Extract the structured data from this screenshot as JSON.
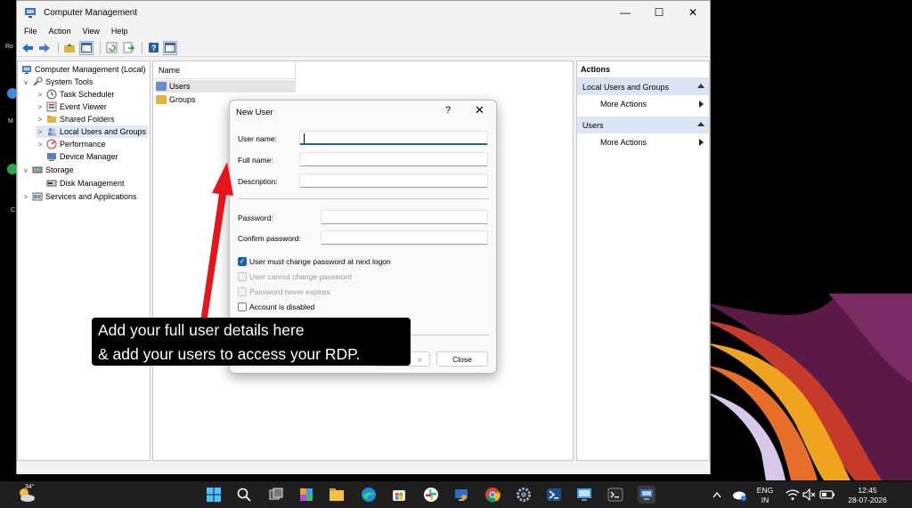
{
  "window": {
    "title": "Computer Management",
    "controls": [
      "minimize-icon",
      "maximize-icon",
      "close-icon"
    ]
  },
  "menu": [
    "File",
    "Action",
    "View",
    "Help"
  ],
  "tree": {
    "items": [
      {
        "label": "Computer Management (Local)",
        "level": 0,
        "expander": "",
        "icon": "computer-management-icon"
      },
      {
        "label": "System Tools",
        "level": 1,
        "expander": "v",
        "icon": "tools-icon"
      },
      {
        "label": "Task Scheduler",
        "level": 2,
        "expander": ">",
        "icon": "clock-icon"
      },
      {
        "label": "Event Viewer",
        "level": 2,
        "expander": ">",
        "icon": "event-viewer-icon"
      },
      {
        "label": "Shared Folders",
        "level": 2,
        "expander": ">",
        "icon": "shared-folders-icon"
      },
      {
        "label": "Local Users and Groups",
        "level": 2,
        "expander": ">",
        "icon": "users-icon"
      },
      {
        "label": "Performance",
        "level": 2,
        "expander": ">",
        "icon": "performance-icon"
      },
      {
        "label": "Device Manager",
        "level": 2,
        "expander": "",
        "icon": "device-manager-icon"
      },
      {
        "label": "Storage",
        "level": 1,
        "expander": "v",
        "icon": "storage-icon"
      },
      {
        "label": "Disk Management",
        "level": 2,
        "expander": "",
        "icon": "disk-icon"
      },
      {
        "label": "Services and Applications",
        "level": 1,
        "expander": ">",
        "icon": "services-icon"
      }
    ]
  },
  "list": {
    "column_header": "Name",
    "rows": [
      "Users",
      "Groups"
    ]
  },
  "actions": {
    "header": "Actions",
    "sections": [
      {
        "title": "Local Users and Groups",
        "item": "More Actions"
      },
      {
        "title": "Users",
        "item": "More Actions"
      }
    ]
  },
  "dialog": {
    "title": "New User",
    "help": "?",
    "close": "✕",
    "fields": {
      "user_name_label": "User name:",
      "user_name_value": "",
      "full_name_label": "Full name:",
      "full_name_value": "",
      "description_label": "Description:",
      "description_value": "",
      "password_label": "Password:",
      "password_value": "",
      "confirm_label": "Confirm password:",
      "confirm_value": ""
    },
    "checkboxes": [
      {
        "label": "User must change password at next logon",
        "checked": true,
        "disabled": false
      },
      {
        "label": "User cannot change password",
        "checked": false,
        "disabled": true
      },
      {
        "label": "Password never expires",
        "checked": false,
        "disabled": true
      },
      {
        "label": "Account is disabled",
        "checked": false,
        "disabled": false
      }
    ],
    "create_button_partial": "e",
    "close_button": "Close"
  },
  "annotation": {
    "line1": "Add your full user details here",
    "line2": "& add your users to access your RDP.",
    "color": "#e8141a"
  },
  "taskbar": {
    "weather_temp": "34°",
    "language": "ENG",
    "region": "IN",
    "time": "12:45",
    "date": "28-07-2026"
  }
}
